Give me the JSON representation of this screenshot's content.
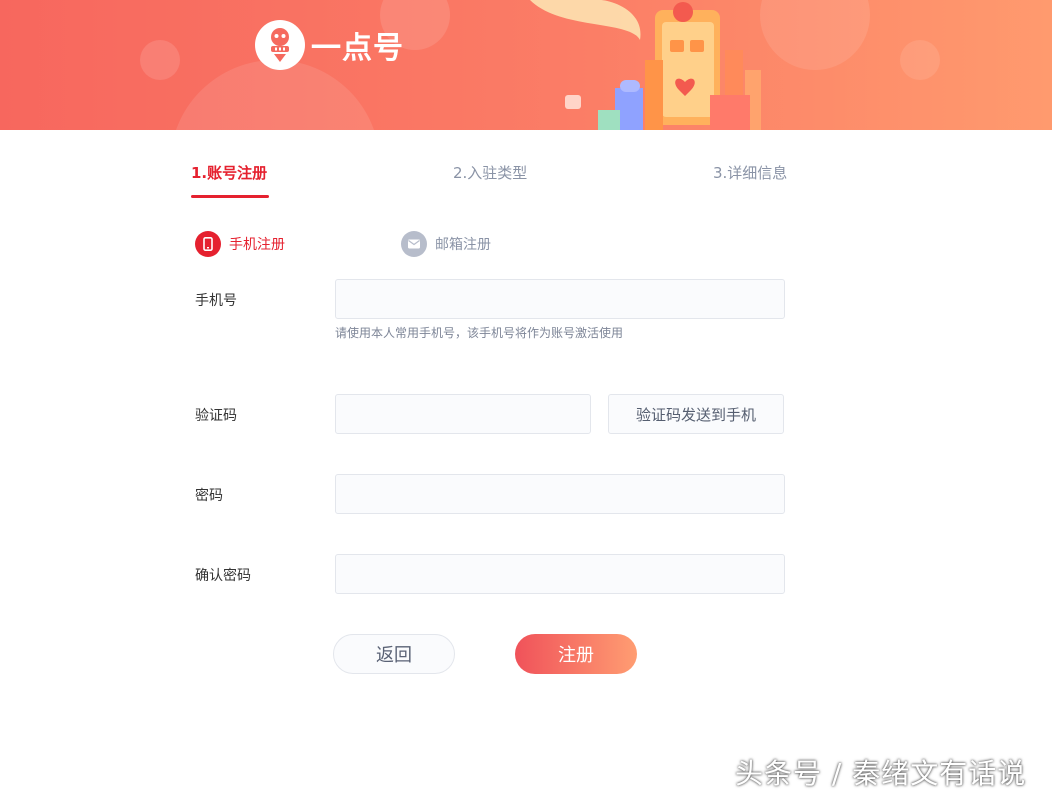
{
  "brand": {
    "logo_text": "一点号"
  },
  "steps": [
    {
      "label": "1.账号注册",
      "active": true
    },
    {
      "label": "2.入驻类型",
      "active": false
    },
    {
      "label": "3.详细信息",
      "active": false
    }
  ],
  "methods": {
    "phone": {
      "label": "手机注册",
      "icon": "phone-icon",
      "selected": true
    },
    "email": {
      "label": "邮箱注册",
      "icon": "mail-icon",
      "selected": false
    }
  },
  "form": {
    "phone": {
      "label": "手机号",
      "value": "",
      "placeholder": "",
      "hint": "请使用本人常用手机号，该手机号将作为账号激活使用"
    },
    "code": {
      "label": "验证码",
      "value": "",
      "placeholder": "",
      "send_button": "验证码发送到手机"
    },
    "password": {
      "label": "密码",
      "value": "",
      "placeholder": ""
    },
    "confirm_password": {
      "label": "确认密码",
      "value": "",
      "placeholder": ""
    }
  },
  "actions": {
    "back": "返回",
    "submit": "注册"
  },
  "watermark": "头条号 / 秦绪文有话说",
  "colors": {
    "accent": "#e5212f",
    "banner_start": "#f7675e",
    "banner_end": "#ff9a6e",
    "muted": "#8a93a6"
  }
}
